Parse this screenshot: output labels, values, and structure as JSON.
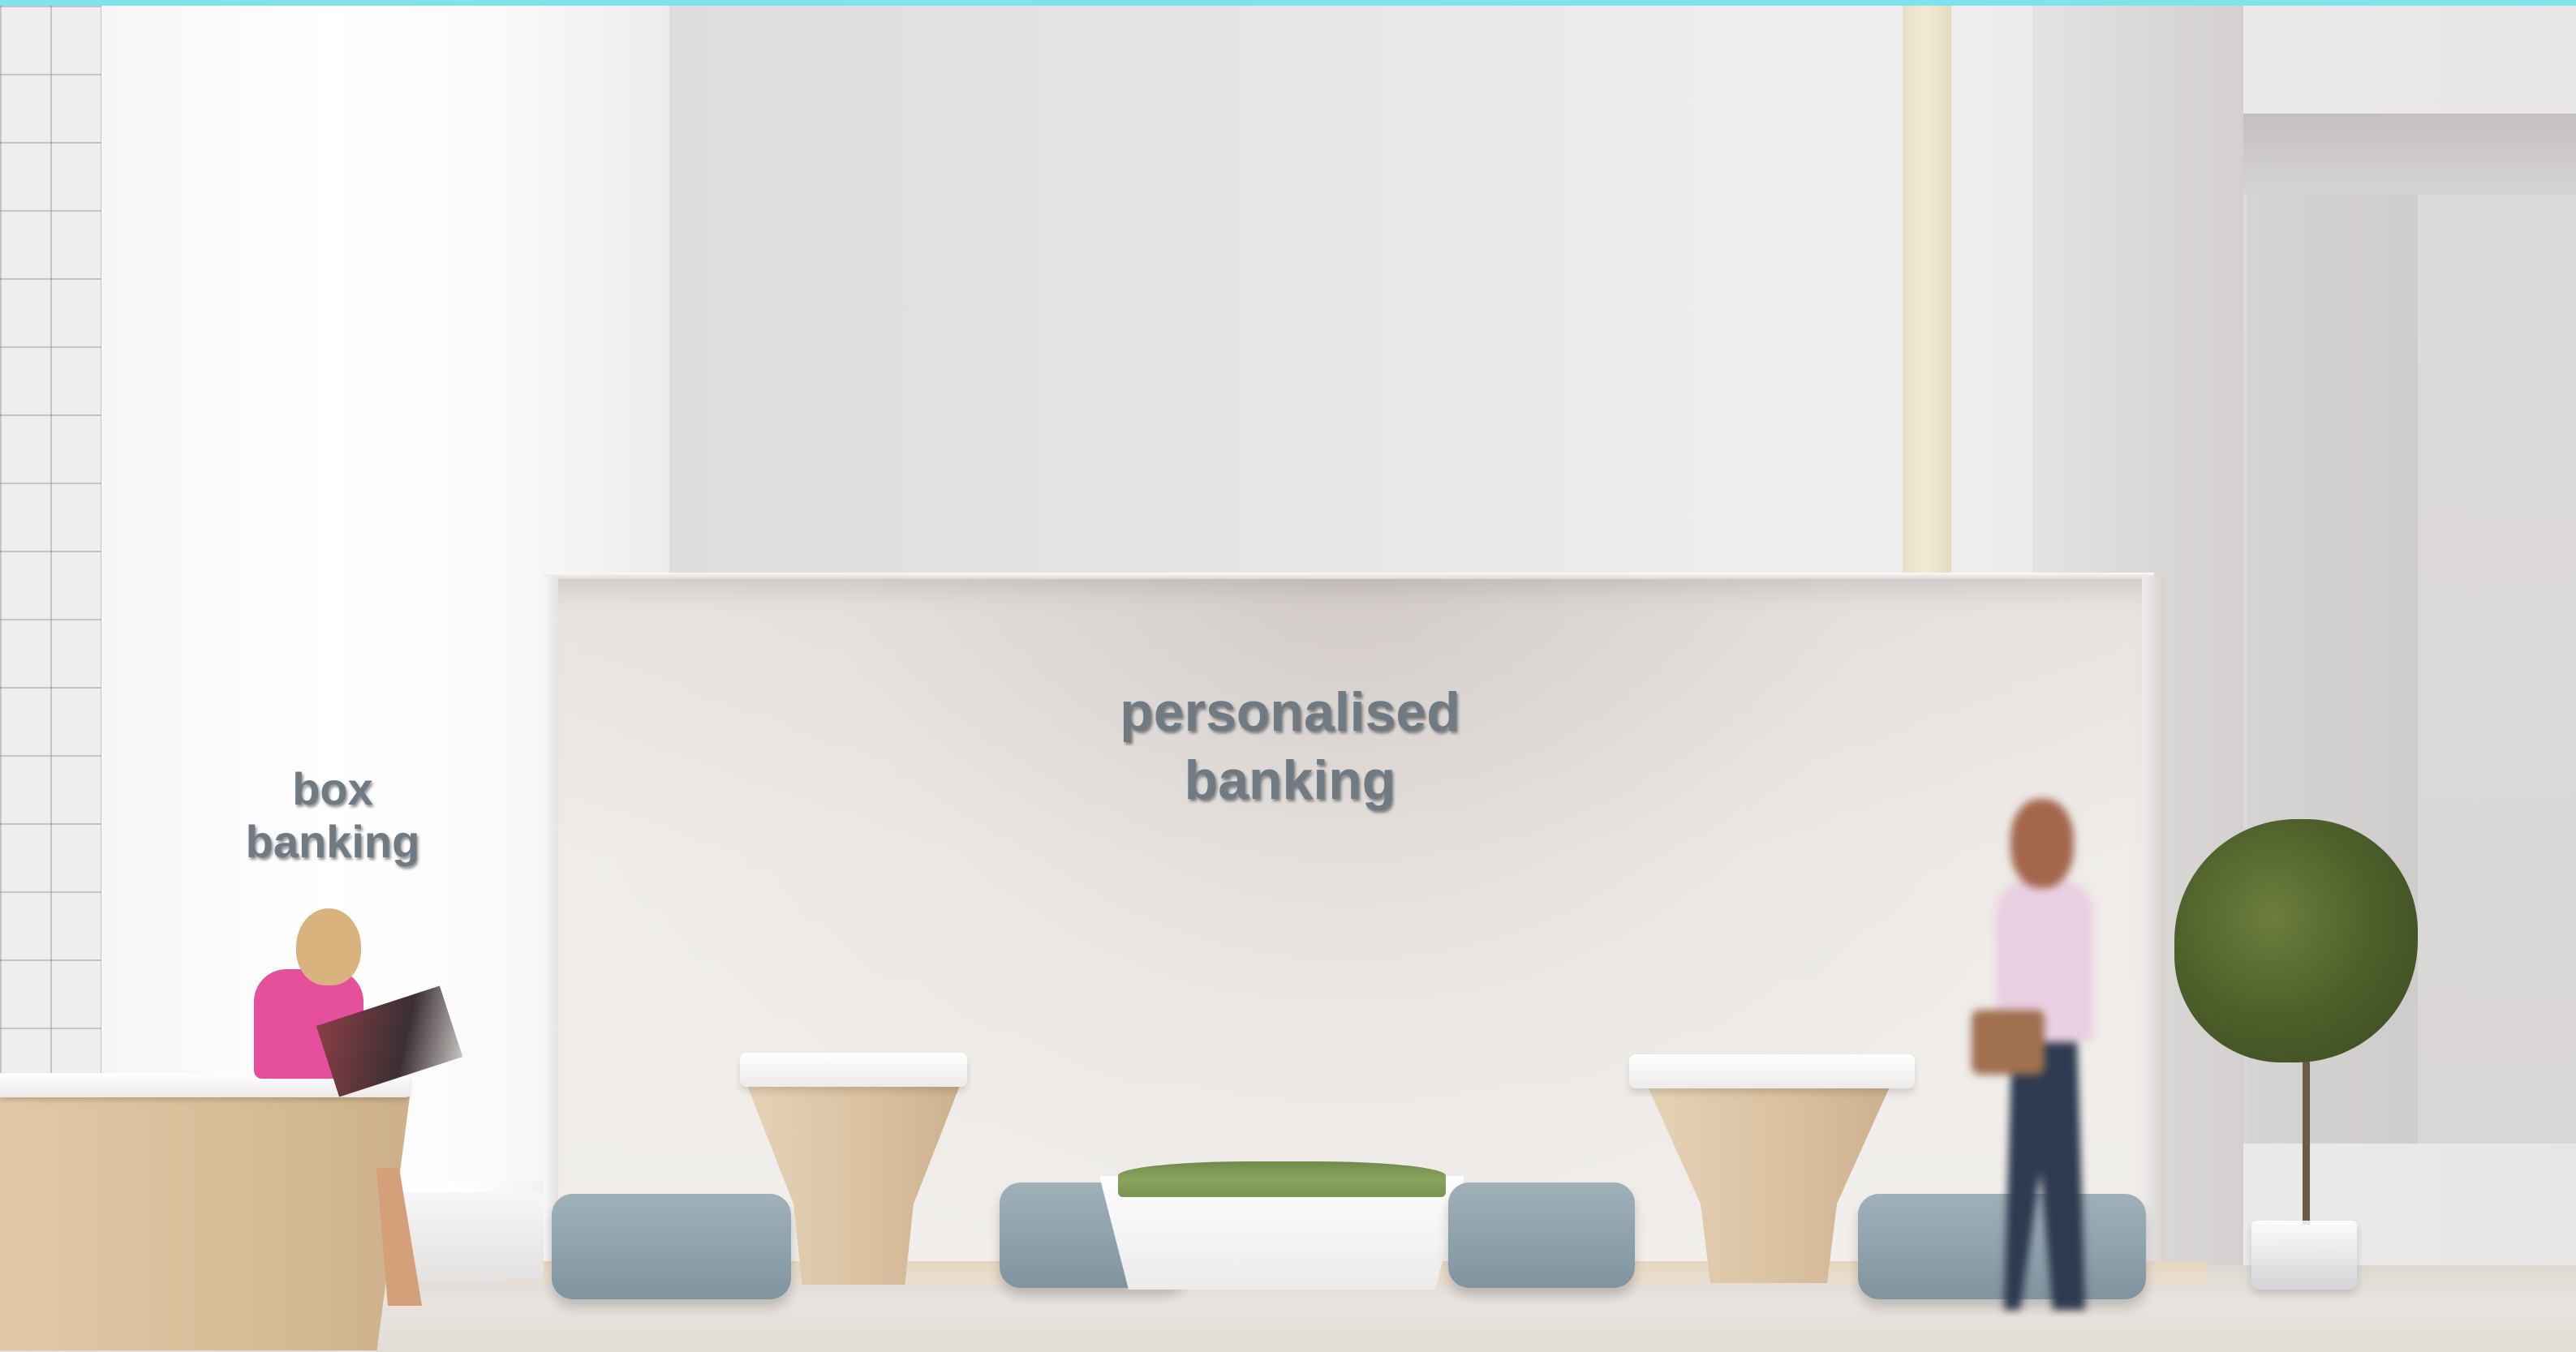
{
  "scene": {
    "signs": {
      "box_banking": "box banking",
      "personalised_line1": "personalised",
      "personalised_line2": "banking"
    }
  }
}
